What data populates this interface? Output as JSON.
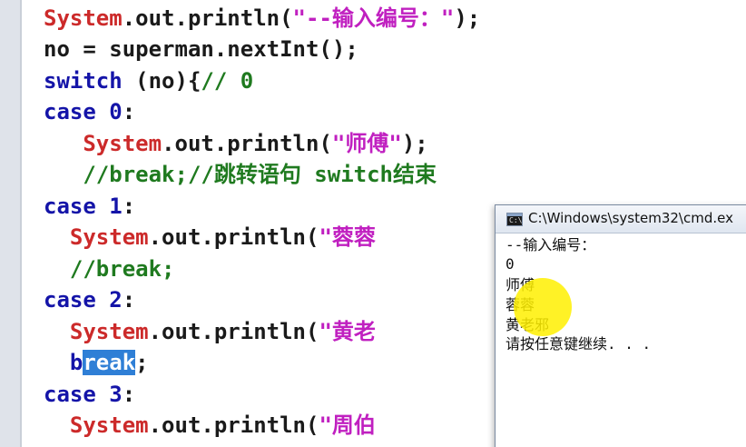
{
  "editor": {
    "lines": [
      {
        "indent": "",
        "parts": [
          {
            "cls": "sys",
            "text": "System"
          },
          {
            "cls": "",
            "text": ".out.println("
          },
          {
            "cls": "str",
            "text": "\"--输入编号：\""
          },
          {
            "cls": "",
            "text": ");"
          }
        ]
      },
      {
        "indent": "",
        "parts": [
          {
            "cls": "",
            "text": "no = superman.nextInt();"
          }
        ]
      },
      {
        "indent": "",
        "parts": [
          {
            "cls": "kw",
            "text": "switch"
          },
          {
            "cls": "",
            "text": " (no){"
          },
          {
            "cls": "cmt",
            "text": "// 0"
          }
        ]
      },
      {
        "indent": "",
        "parts": [
          {
            "cls": "kw",
            "text": "case"
          },
          {
            "cls": "",
            "text": " "
          },
          {
            "cls": "num",
            "text": "0"
          },
          {
            "cls": "",
            "text": ":"
          }
        ]
      },
      {
        "indent": "   ",
        "parts": [
          {
            "cls": "sys",
            "text": "System"
          },
          {
            "cls": "",
            "text": ".out.println("
          },
          {
            "cls": "str",
            "text": "\"师傅\""
          },
          {
            "cls": "",
            "text": ");"
          }
        ]
      },
      {
        "indent": "   ",
        "parts": [
          {
            "cls": "cmt",
            "text": "//break;//跳转语句 switch结束"
          }
        ]
      },
      {
        "indent": "",
        "parts": [
          {
            "cls": "kw",
            "text": "case"
          },
          {
            "cls": "",
            "text": " "
          },
          {
            "cls": "num",
            "text": "1"
          },
          {
            "cls": "",
            "text": ":"
          }
        ]
      },
      {
        "indent": "  ",
        "parts": [
          {
            "cls": "sys",
            "text": "System"
          },
          {
            "cls": "",
            "text": ".out.println("
          },
          {
            "cls": "str",
            "text": "\"蓉蓉"
          }
        ]
      },
      {
        "indent": "  ",
        "parts": [
          {
            "cls": "cmt",
            "text": "//break;"
          }
        ]
      },
      {
        "indent": "",
        "parts": [
          {
            "cls": "kw",
            "text": "case"
          },
          {
            "cls": "",
            "text": " "
          },
          {
            "cls": "num",
            "text": "2"
          },
          {
            "cls": "",
            "text": ":"
          }
        ]
      },
      {
        "indent": "  ",
        "parts": [
          {
            "cls": "sys",
            "text": "System"
          },
          {
            "cls": "",
            "text": ".out.println("
          },
          {
            "cls": "str",
            "text": "\"黄老"
          }
        ]
      },
      {
        "indent": "  ",
        "parts": [
          {
            "cls": "kw",
            "text": "b"
          },
          {
            "cls": "kw sel",
            "text": "reak"
          },
          {
            "cls": "",
            "text": ";"
          }
        ]
      },
      {
        "indent": "",
        "parts": [
          {
            "cls": "kw",
            "text": "case"
          },
          {
            "cls": "",
            "text": " "
          },
          {
            "cls": "num",
            "text": "3"
          },
          {
            "cls": "",
            "text": ":"
          }
        ]
      },
      {
        "indent": "  ",
        "parts": [
          {
            "cls": "sys",
            "text": "System"
          },
          {
            "cls": "",
            "text": ".out.println("
          },
          {
            "cls": "str",
            "text": "\"周伯"
          }
        ]
      }
    ]
  },
  "console": {
    "title": "C:\\Windows\\system32\\cmd.ex",
    "icon": "cmd-window-icon",
    "output": [
      "--输入编号：",
      "0",
      "师傅",
      "蓉蓉",
      "黄老邪",
      "请按任意键继续. . ."
    ]
  },
  "colors": {
    "keyword": "#1414a8",
    "system": "#cc2a2a",
    "string": "#c020c0",
    "comment": "#1f7a1f",
    "selection": "#2f7fd6",
    "cursor_highlight": "#fff000"
  }
}
